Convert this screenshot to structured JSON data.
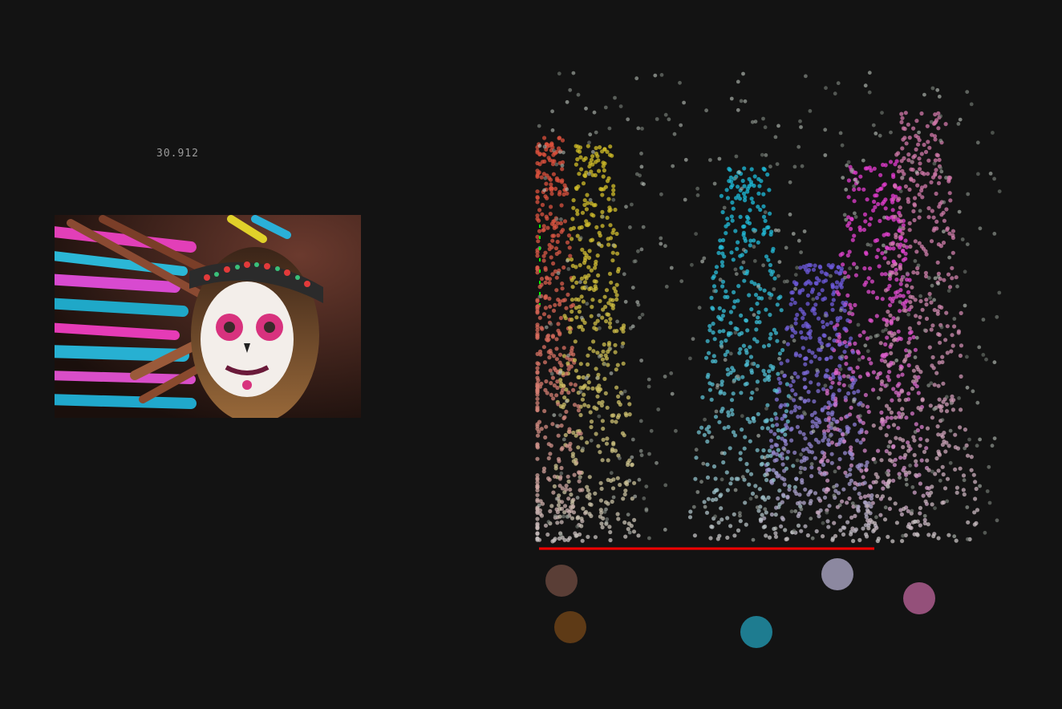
{
  "readout": "30.912",
  "swatches": [
    {
      "name": "swatch-brown",
      "color": "#5a3e36"
    },
    {
      "name": "swatch-dark-orange",
      "color": "#5e3a16"
    },
    {
      "name": "swatch-teal",
      "color": "#1e7c90"
    },
    {
      "name": "swatch-lavender",
      "color": "#8c88a0"
    },
    {
      "name": "swatch-pink",
      "color": "#94507a"
    }
  ],
  "colors": {
    "background": "#131313",
    "x_axis": "#ff0000",
    "y_axis": "#00ff00"
  }
}
